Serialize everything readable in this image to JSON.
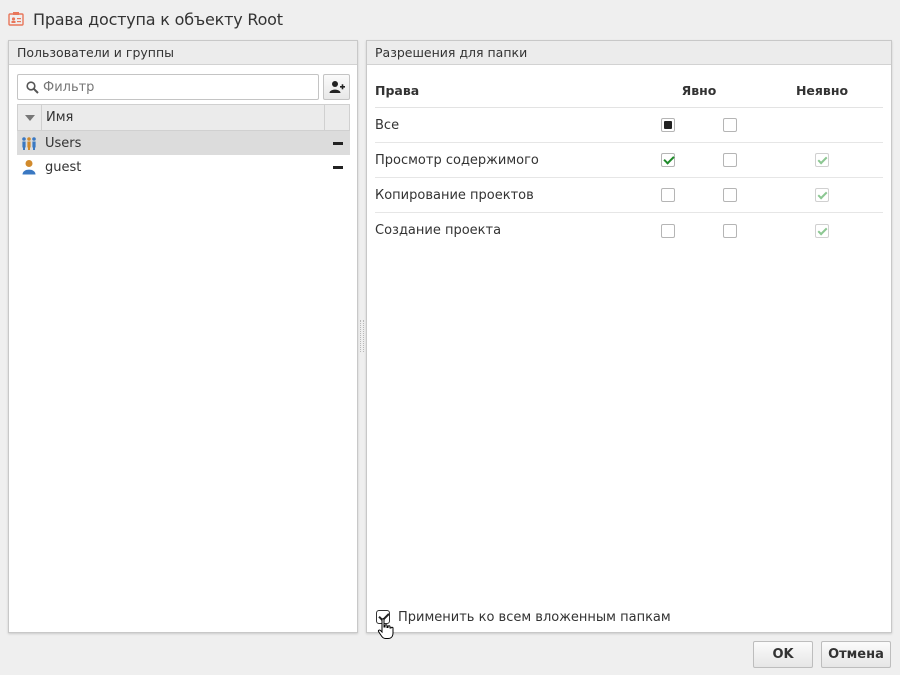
{
  "window": {
    "title": "Права доступа к объекту Root",
    "icon": "access-rights-icon",
    "accent": "#e8765a"
  },
  "users_panel": {
    "header": "Пользователи и группы",
    "filter": {
      "placeholder": "Фильтр",
      "value": ""
    },
    "add_button_icon": "add-user-icon",
    "grid": {
      "name_column": "Имя",
      "rows": [
        {
          "name": "Users",
          "icon": "group-icon",
          "selected": true
        },
        {
          "name": "guest",
          "icon": "user-icon",
          "selected": false
        }
      ]
    }
  },
  "permissions_panel": {
    "header": "Разрешения для папки",
    "columns": {
      "right": "Права",
      "explicit": "Явно",
      "implicit": "Неявно"
    },
    "rows": [
      {
        "name": "Все",
        "allow": "mixed",
        "deny": "unchecked",
        "implicit": "none"
      },
      {
        "name": "Просмотр содержимого",
        "allow": "checked",
        "deny": "unchecked",
        "implicit": "checked"
      },
      {
        "name": "Копирование проектов",
        "allow": "unchecked",
        "deny": "unchecked",
        "implicit": "checked"
      },
      {
        "name": "Создание проекта",
        "allow": "unchecked",
        "deny": "unchecked",
        "implicit": "checked"
      }
    ],
    "apply_to_subfolders": {
      "label": "Применить ко всем вложенным папкам",
      "checked": true
    }
  },
  "buttons": {
    "ok": "OK",
    "cancel": "Отмена"
  }
}
